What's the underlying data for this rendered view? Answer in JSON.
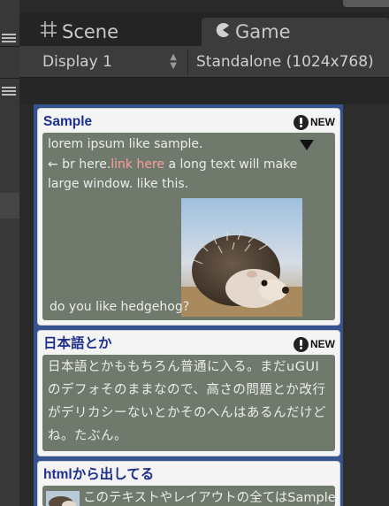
{
  "tabs": {
    "scene_label": "Scene",
    "game_label": "Game"
  },
  "toolbar": {
    "display_label": "Display 1",
    "aspect_label": "Standalone (1024x768)"
  },
  "cards": [
    {
      "title": "Sample",
      "badge": "NEW",
      "line1": "lorem ipsum like sample.",
      "line2_prefix": "← br here.",
      "line2_link": "link here",
      "line2_suffix": " a long text will make",
      "line3": "large window. like this.",
      "question": "do you like hedgehog?"
    },
    {
      "title": "日本語とか",
      "badge": "NEW",
      "text": "日本語とかももちろん普通に入る。まだuGUIのデフォそのままなので、高さの問題とか改行がデリカシーないとかそのへんはあるんだけどね。たぶん。"
    },
    {
      "title": "htmlから出してる",
      "text": "このテキストやレイアウトの全てはSample"
    }
  ],
  "colors": {
    "game_bg": "#34538f",
    "card_body": "#6f7a6c",
    "title_blue": "#1e2f8c",
    "link": "#ff9d9d"
  }
}
